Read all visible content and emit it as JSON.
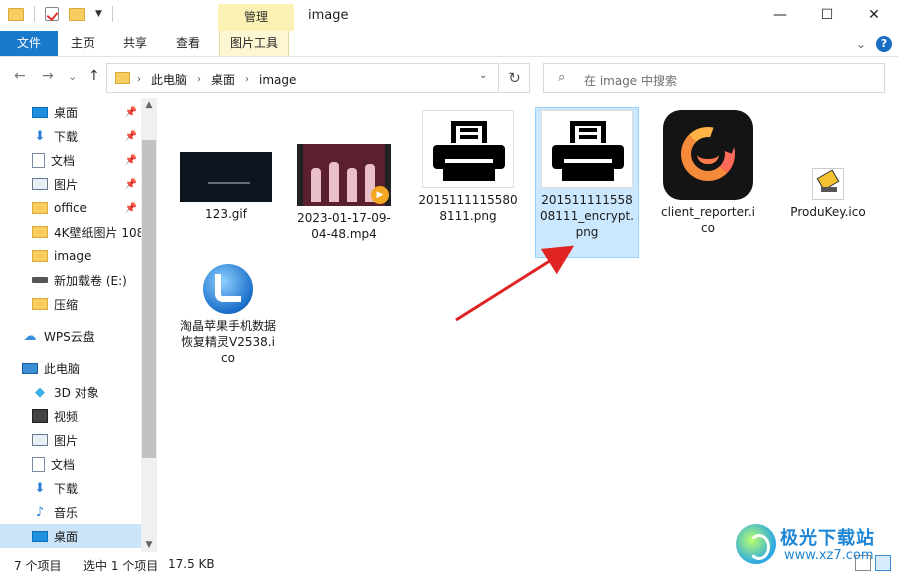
{
  "window": {
    "title": "image",
    "manage_tab": "管理",
    "minimize": "—",
    "maximize": "☐",
    "close": "✕"
  },
  "ribbon": {
    "tabs": [
      "文件",
      "主页",
      "共享",
      "查看",
      "图片工具"
    ],
    "expand": "⌄",
    "help": "?"
  },
  "address": {
    "crumbs": [
      "此电脑",
      "桌面",
      "image"
    ],
    "search_placeholder": "在 image 中搜索"
  },
  "nav": {
    "back": "←",
    "forward": "→",
    "recent": "⌄",
    "up": "↑",
    "refresh": "↻",
    "chev": "›",
    "search_icon": "⌕"
  },
  "sidebar": {
    "items": [
      {
        "label": "桌面",
        "icon": "desktop-icon",
        "pinned": true
      },
      {
        "label": "下载",
        "icon": "download-icon",
        "pinned": true
      },
      {
        "label": "文档",
        "icon": "document-icon",
        "pinned": true
      },
      {
        "label": "图片",
        "icon": "pictures-icon",
        "pinned": true
      },
      {
        "label": "office",
        "icon": "folder-icon",
        "pinned": true
      },
      {
        "label": "4K壁纸图片 108",
        "icon": "folder-icon",
        "pinned": false
      },
      {
        "label": "image",
        "icon": "folder-icon",
        "pinned": false
      },
      {
        "label": "新加载卷 (E:)",
        "icon": "drive-icon",
        "pinned": false
      },
      {
        "label": "压缩",
        "icon": "folder-icon",
        "pinned": false
      },
      {
        "label": "WPS云盘",
        "icon": "cloud-icon",
        "pinned": false
      },
      {
        "label": "此电脑",
        "icon": "computer-icon",
        "pinned": false
      },
      {
        "label": "3D 对象",
        "icon": "3d-objects-icon",
        "pinned": false
      },
      {
        "label": "视频",
        "icon": "videos-icon",
        "pinned": false
      },
      {
        "label": "图片",
        "icon": "pictures-icon",
        "pinned": false
      },
      {
        "label": "文档",
        "icon": "document-icon",
        "pinned": false
      },
      {
        "label": "下载",
        "icon": "download-icon",
        "pinned": false
      },
      {
        "label": "音乐",
        "icon": "music-icon",
        "pinned": false
      },
      {
        "label": "桌面",
        "icon": "desktop-icon",
        "pinned": false
      }
    ],
    "selected_index": 17
  },
  "files": [
    {
      "name": "123.gif",
      "type": "gif"
    },
    {
      "name": "2023-01-17-09-04-48.mp4",
      "type": "mp4"
    },
    {
      "name": "20151111155808111.png",
      "type": "png"
    },
    {
      "name": "20151111155808111_encrypt.png",
      "type": "png",
      "selected": true
    },
    {
      "name": "client_reporter.ico",
      "type": "ico"
    },
    {
      "name": "ProduKey.ico",
      "type": "ico"
    },
    {
      "name": "淘晶苹果手机数据恢复精灵V2538.ico",
      "type": "ico"
    }
  ],
  "status": {
    "count": "7 个项目",
    "selection": "选中 1 个项目",
    "size": "17.5 KB"
  },
  "watermark": {
    "line1": "极光下载站",
    "line2": "www.xz7.com"
  },
  "colors": {
    "file_tab": "#1979ca",
    "selection": "#cce8ff",
    "arrow": "#e02424"
  }
}
